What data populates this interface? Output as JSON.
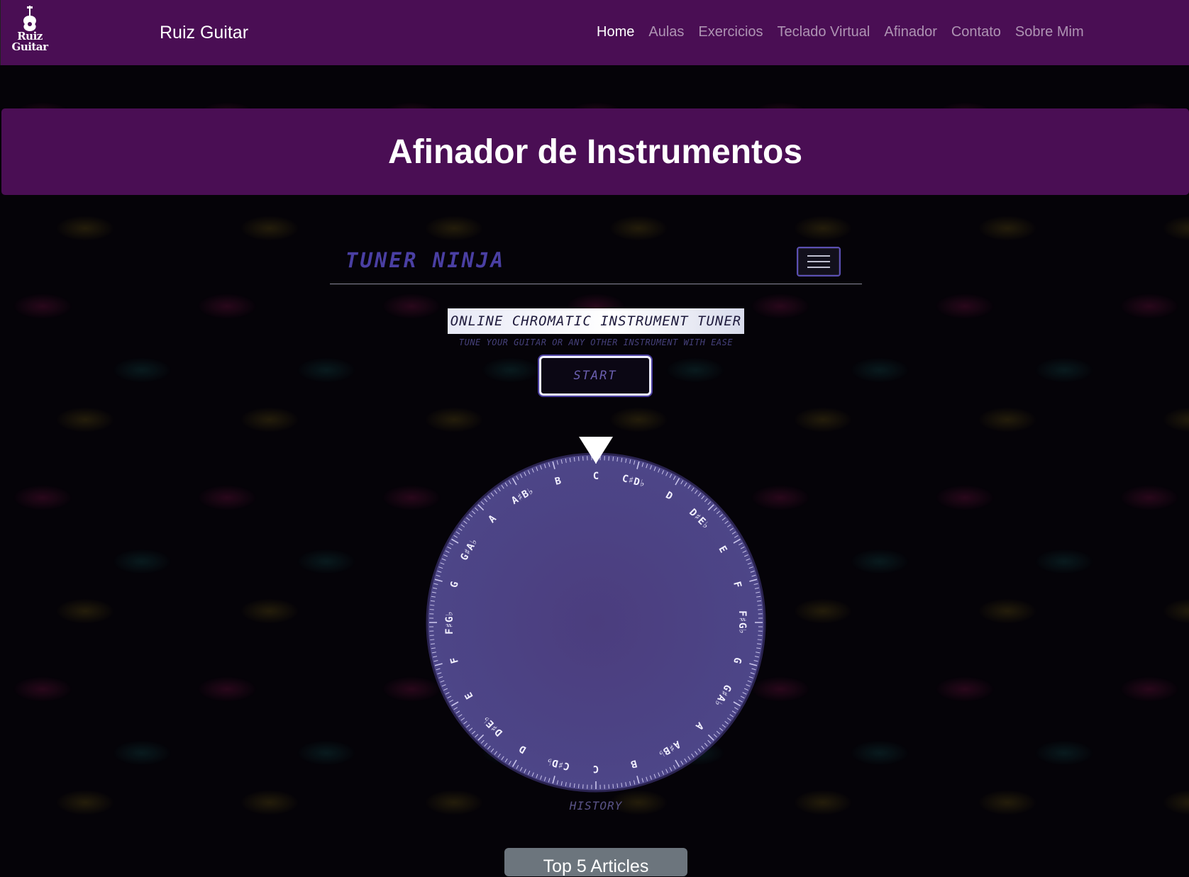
{
  "navbar": {
    "logo_text": [
      "Ruiz",
      "Guitar"
    ],
    "brand": "Ruiz Guitar",
    "links": [
      {
        "label": "Home",
        "active": true
      },
      {
        "label": "Aulas",
        "active": false
      },
      {
        "label": "Exercicios",
        "active": false
      },
      {
        "label": "Teclado Virtual",
        "active": false
      },
      {
        "label": "Afinador",
        "active": false
      },
      {
        "label": "Contato",
        "active": false
      },
      {
        "label": "Sobre Mim",
        "active": false
      }
    ]
  },
  "page_title": "Afinador de Instrumentos",
  "tuner": {
    "logo": "TUNER NINJA",
    "menu_icon": "hamburger-icon",
    "subtitle": "ONLINE CHROMATIC INSTRUMENT TUNER",
    "tagline": "TUNE YOUR GUITAR OR ANY OTHER INSTRUMENT WITH EASE",
    "start_label": "START",
    "dial_notes": [
      "C",
      "C♯D♭",
      "D",
      "D♯E♭",
      "E",
      "F",
      "F♯G♭",
      "G",
      "G♯A♭",
      "A",
      "A♯B♭",
      "B",
      "C",
      "C♯D♭",
      "D",
      "D♯E♭",
      "E",
      "F",
      "F♯G♭",
      "G",
      "G♯A♭",
      "A",
      "A♯B♭",
      "B"
    ],
    "history_label": "HISTORY"
  },
  "top_articles_label": "Top 5 Articles",
  "colors": {
    "navbar": "#4a0e54",
    "dial_fill": "#4a4080",
    "accent": "#4b3fa0"
  }
}
